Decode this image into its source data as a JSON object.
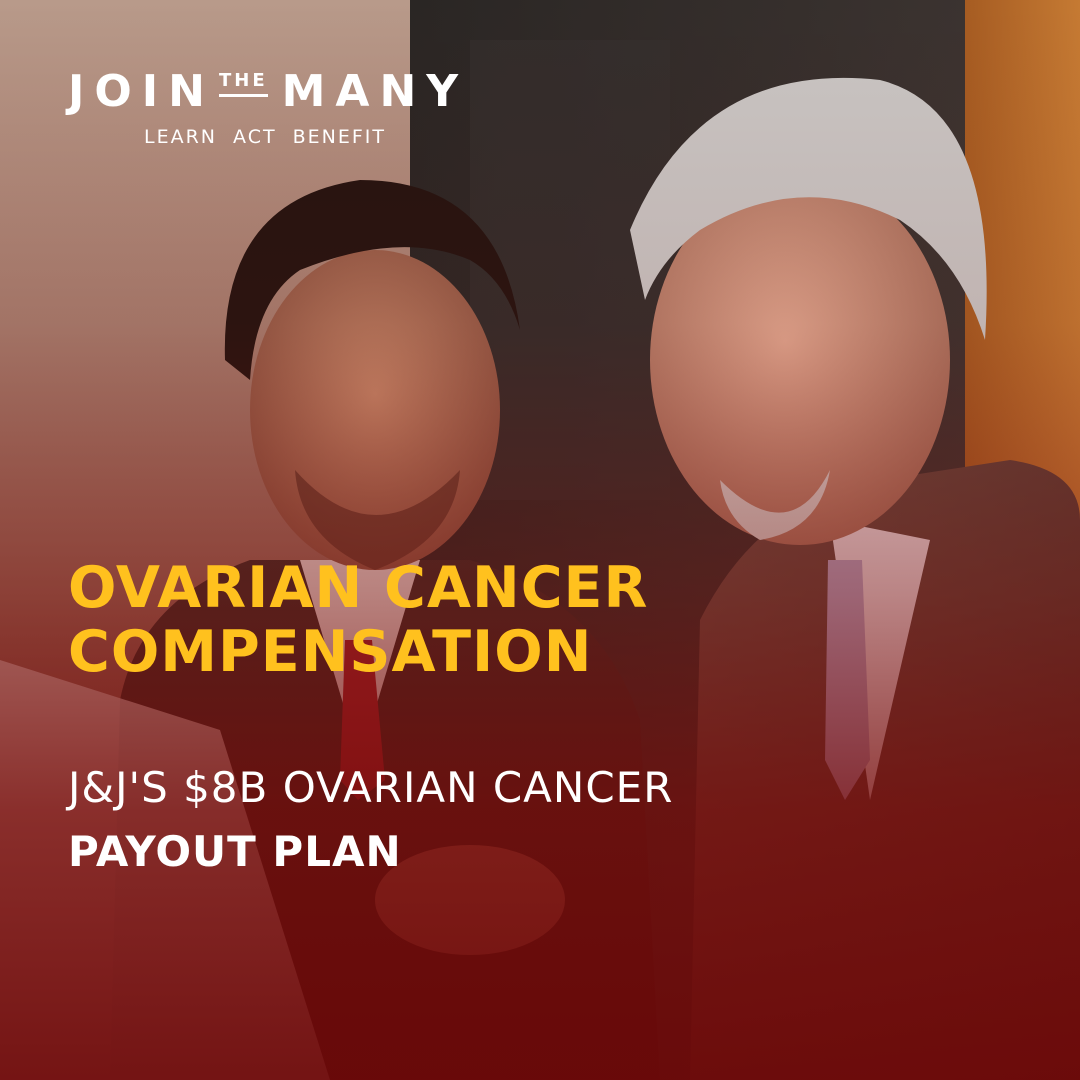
{
  "brand": {
    "logo_join": "JOIN",
    "logo_the": "THE",
    "logo_many": "MANY",
    "tagline": "LEARN ACT BENEFIT"
  },
  "headline": {
    "line1": "OVARIAN CANCER",
    "line2": "COMPENSATION"
  },
  "subheadline": {
    "line1": "J&J'S $8B OVARIAN CANCER",
    "line2": "PAYOUT PLAN"
  },
  "colors": {
    "headline": "#ffc11e",
    "text": "#ffffff",
    "overlay": "#7a0e0c"
  },
  "photo": {
    "subject": "two-men-in-suits-reviewing-document"
  }
}
